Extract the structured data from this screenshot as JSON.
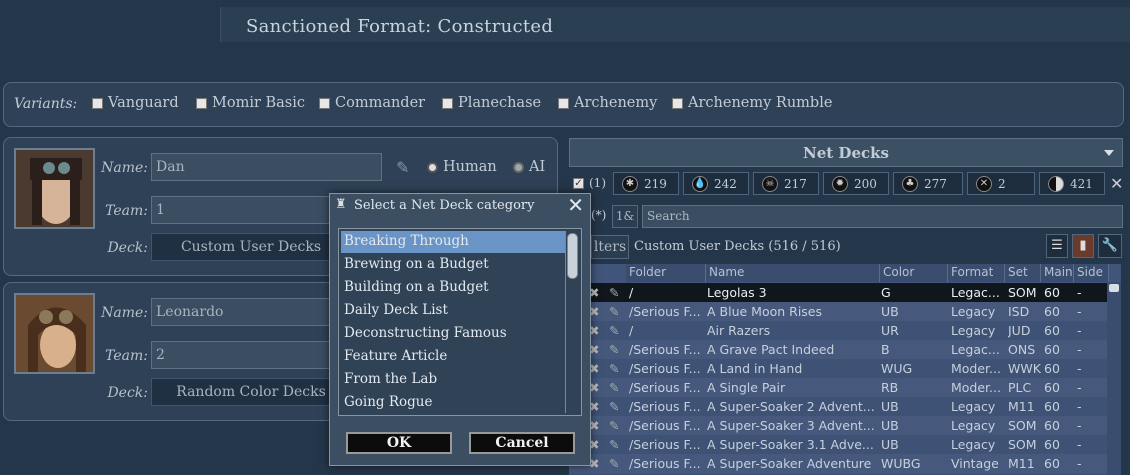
{
  "header": {
    "title": "Sanctioned Format: Constructed"
  },
  "variants": {
    "label": "Variants:",
    "items": [
      "Vanguard",
      "Momir Basic",
      "Commander",
      "Planechase",
      "Archenemy",
      "Archenemy Rumble"
    ]
  },
  "players": [
    {
      "name_label": "Name:",
      "name": "Dan",
      "team_label": "Team:",
      "team": "1",
      "deck_label": "Deck:",
      "deck": "Custom User Decks",
      "human": "Human",
      "ai": "AI"
    },
    {
      "name_label": "Name:",
      "name": "Leonardo",
      "team_label": "Team:",
      "team": "2",
      "deck_label": "Deck:",
      "deck": "Random Color Decks"
    }
  ],
  "netdecks": {
    "selector": "Net Decks",
    "all_count": "(1)",
    "color_counts": [
      "219",
      "242",
      "217",
      "200",
      "277",
      "2",
      "421"
    ],
    "search_placeholder": "Search",
    "search_prefix": "(*)",
    "search_toggle": "1&",
    "filters_label": "lters",
    "deck_count": "Custom User Decks (516 / 516)"
  },
  "table": {
    "columns": [
      "Folder",
      "Name",
      "Color",
      "Format",
      "Set",
      "Main",
      "Side"
    ],
    "rows": [
      {
        "folder": "/",
        "name": "Legolas 3",
        "color": "G",
        "format": "Legac...",
        "set": "SOM",
        "main": "60",
        "side": "-"
      },
      {
        "folder": "/Serious F...",
        "name": "A Blue Moon Rises",
        "color": "UB",
        "format": "Legacy",
        "set": "ISD",
        "main": "60",
        "side": "-"
      },
      {
        "folder": "/",
        "name": "Air Razers",
        "color": "UR",
        "format": "Legacy",
        "set": "JUD",
        "main": "60",
        "side": "-"
      },
      {
        "folder": "/Serious F...",
        "name": "A Grave Pact Indeed",
        "color": "B",
        "format": "Legac...",
        "set": "ONS",
        "main": "60",
        "side": "-"
      },
      {
        "folder": "/Serious F...",
        "name": "A Land in Hand",
        "color": "WUG",
        "format": "Moder...",
        "set": "WWK",
        "main": "60",
        "side": "-"
      },
      {
        "folder": "/Serious F...",
        "name": "A Single Pair",
        "color": "RB",
        "format": "Moder...",
        "set": "PLC",
        "main": "60",
        "side": "-"
      },
      {
        "folder": "/Serious F...",
        "name": "A Super-Soaker 2 Advent...",
        "color": "UB",
        "format": "Legacy",
        "set": "M11",
        "main": "60",
        "side": "-"
      },
      {
        "folder": "/Serious F...",
        "name": "A Super-Soaker 3 Advent...",
        "color": "UB",
        "format": "Legacy",
        "set": "SOM",
        "main": "60",
        "side": "-"
      },
      {
        "folder": "/Serious F...",
        "name": "A Super-Soaker 3.1 Adve...",
        "color": "UB",
        "format": "Legacy",
        "set": "SOM",
        "main": "60",
        "side": "-"
      },
      {
        "folder": "/Serious F...",
        "name": "A Super-Soaker Adventure",
        "color": "WUBG",
        "format": "Vintage",
        "set": "M11",
        "main": "60",
        "side": "-"
      }
    ]
  },
  "dialog": {
    "title": "Select a Net Deck category",
    "categories": [
      "Breaking Through",
      "Brewing on a Budget",
      "Building on a Budget",
      "Daily Deck List",
      "Deconstructing Famous",
      "Feature Article",
      "From the Lab",
      "Going Rogue"
    ],
    "ok": "OK",
    "cancel": "Cancel"
  }
}
